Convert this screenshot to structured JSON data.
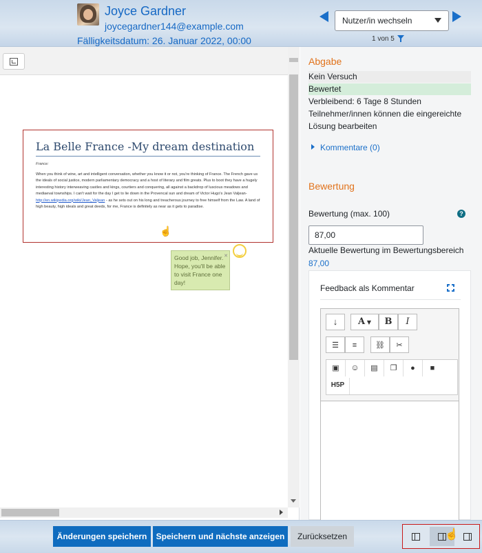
{
  "header": {
    "user_name": "Joyce Gardner",
    "user_email": "joycegardner144@example.com",
    "due_date": "Fälligkeitsdatum: 26. Januar 2022, 00:00",
    "user_select_label": "Nutzer/in wechseln",
    "counter": "1 von 5"
  },
  "document": {
    "title": "La Belle France -My dream destination",
    "subtitle": "France:",
    "body_part1": "When you think of wine, art and intelligent conversation, whether you know it or not, you're thinking of France. The French gave us the ideals of social justice, modern parliamentary democracy and a host of literary and film greats. Plus to boot they have a hugely interesting history interweaving castles and kings, courtiers and conquering, all against a backdrop of luscious meadows and mediaeval townships. I can't wait for the day I get to lie down in the Provencal sun and dream of Victor Hugo's Jean Valjean-",
    "link": "http://en.wikipedia.org/wiki/Jean_Valjean",
    "body_part2": "- as he sets out on his long and treacherous journey to free himself from the Law. A land of high beauty, high ideals and great deeds, for me, France is definitely as near as it gets to paradise.",
    "annotation": "Good job, Jennifer. Hope, you'll be able to visit France one day!"
  },
  "submission": {
    "section_title": "Abgabe",
    "attempt_status": "Kein Versuch",
    "grading_status": "Bewertet",
    "time_remaining": "Verbleibend: 6 Tage 8 Stunden",
    "edit_note_line1": "Teilnehmer/innen können die eingereichte",
    "edit_note_line2": "Lösung bearbeiten",
    "comments_label": "Kommentare (0)"
  },
  "grading": {
    "section_title": "Bewertung",
    "grade_label": "Bewertung (max. 100)",
    "grade_value": "87,00",
    "current_grade_label": "Aktuelle Bewertung im Bewertungsbereich",
    "current_grade_value": "87,00",
    "feedback_title": "Feedback als Kommentar"
  },
  "editor_toolbar": {
    "font_label": "A",
    "bold_label": "B",
    "italic_label": "I",
    "h5p_label": "H5P"
  },
  "footer": {
    "save_label": "Änderungen speichern",
    "save_next_label": "Speichern und nächste anzeigen",
    "reset_label": "Zurücksetzen"
  },
  "colors": {
    "accent": "#0f6cbf",
    "link": "#1a6fc9",
    "section_heading": "#e1721b",
    "graded_bg": "#d4edda",
    "doc_frame": "#b0312d"
  }
}
